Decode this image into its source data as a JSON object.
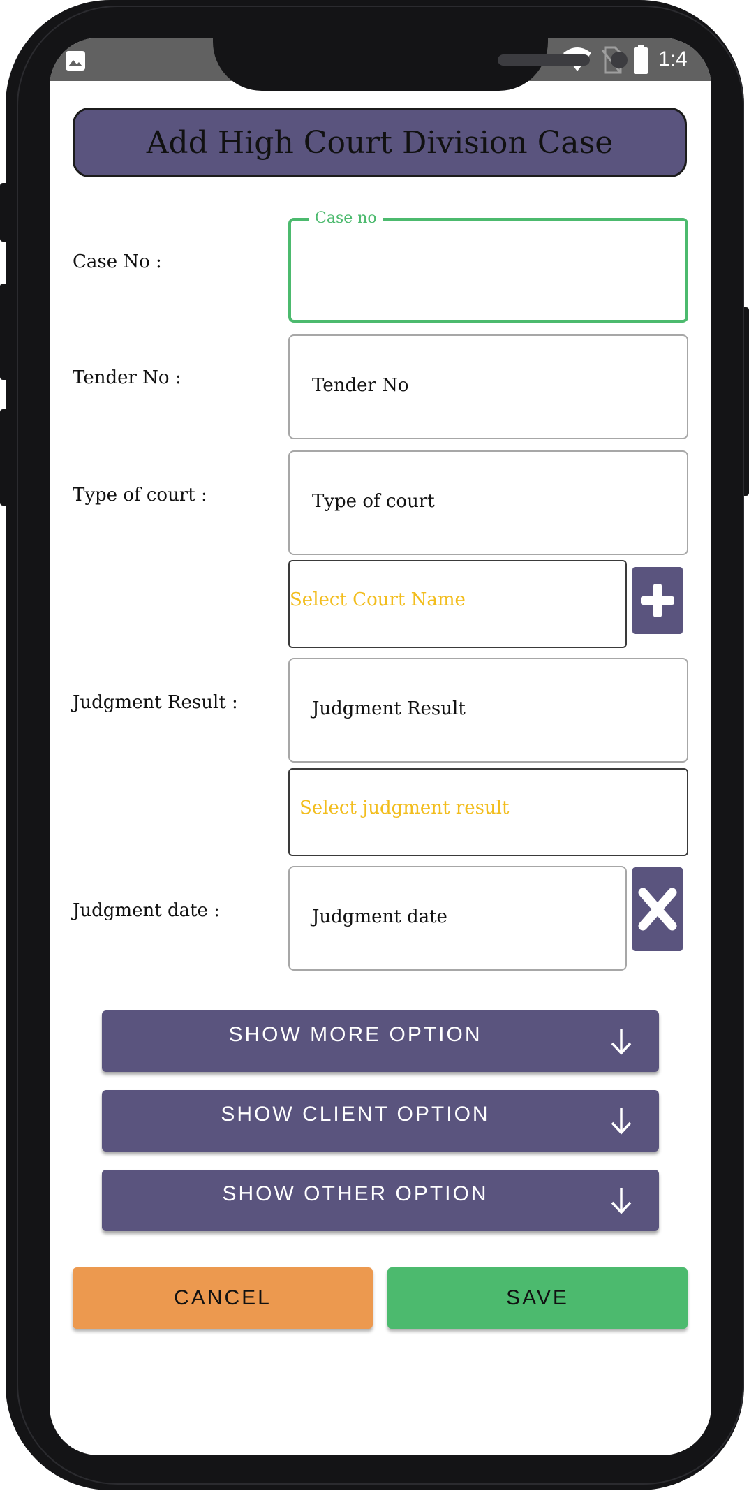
{
  "status_bar": {
    "time": "1:4"
  },
  "header": {
    "title": "Add High Court Division Case"
  },
  "form": {
    "case_no": {
      "label": "Case No :",
      "float_label": "Case no",
      "value": ""
    },
    "tender_no": {
      "label": "Tender No :",
      "placeholder": "Tender No"
    },
    "type_of_court": {
      "label": "Type of court :",
      "placeholder": "Type of court"
    },
    "court_name_select": {
      "placeholder": "Select Court Name"
    },
    "judgment_result": {
      "label": "Judgment Result :",
      "placeholder": "Judgment Result"
    },
    "judgment_result_select": {
      "placeholder": "Select judgment result"
    },
    "judgment_date": {
      "label": "Judgment date :",
      "placeholder": "Judgment date"
    }
  },
  "options": [
    {
      "label": "SHOW MORE OPTION"
    },
    {
      "label": "SHOW CLIENT OPTION"
    },
    {
      "label": "SHOW OTHER OPTION"
    }
  ],
  "actions": {
    "cancel_label": "CANCEL",
    "save_label": "SAVE"
  },
  "colors": {
    "primary": "#5a547e",
    "accent_green": "#4cba6e",
    "select_text": "#f2bd1d",
    "cancel_bg": "#ec994f",
    "save_bg": "#4cba6e"
  },
  "icons": {
    "add_court": "plus-icon",
    "clear_date": "close-icon",
    "expand": "arrow-down-icon",
    "status": [
      "image-icon",
      "wifi-icon",
      "no-sim-icon",
      "battery-icon"
    ]
  }
}
